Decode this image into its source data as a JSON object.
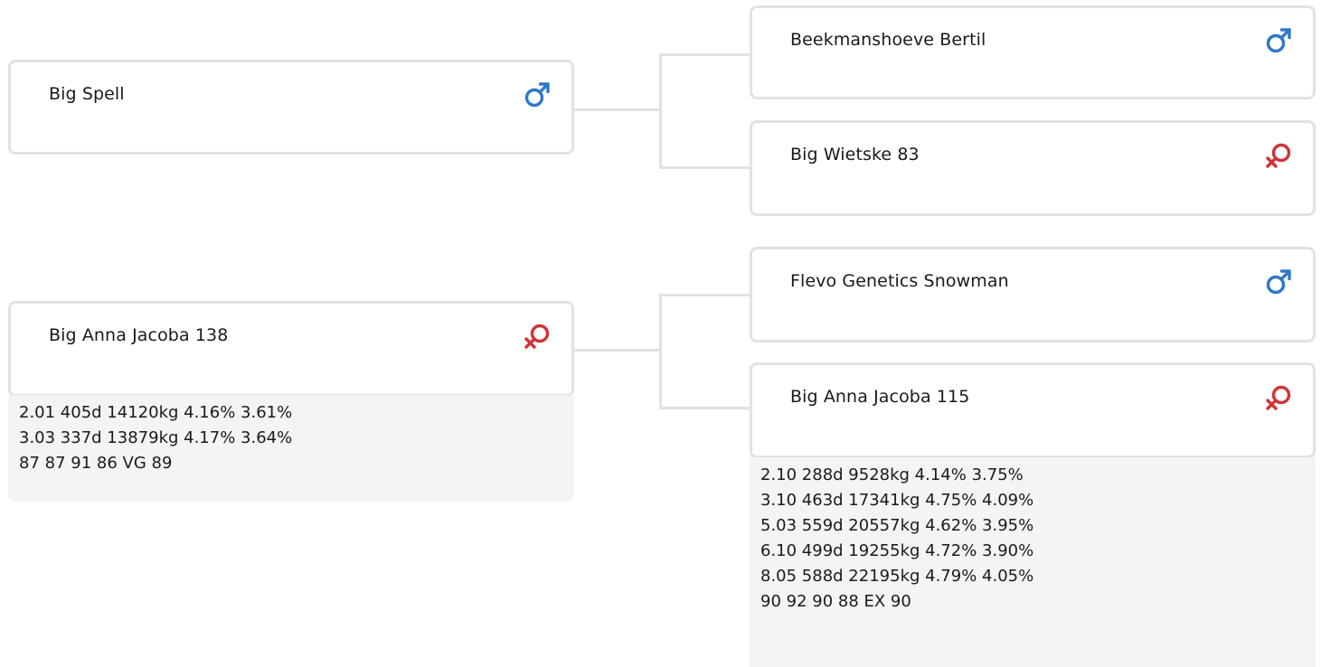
{
  "colors": {
    "male": "#2f78c8",
    "female": "#d03339",
    "border": "#e2e2e2",
    "stats_background": "#f4f4f4"
  },
  "parents": {
    "sire": {
      "name": "Big Spell",
      "sex": "male",
      "icon": "male-symbol-icon"
    },
    "dam": {
      "name": "Big Anna Jacoba 138",
      "sex": "female",
      "icon": "female-symbol-icon",
      "stats": [
        "2.01 405d 14120kg 4.16% 3.61%",
        "3.03 337d 13879kg 4.17% 3.64%",
        "87 87 91 86 VG 89"
      ]
    }
  },
  "grandparents": {
    "sire_sire": {
      "name": "Beekmanshoeve Bertil",
      "sex": "male",
      "icon": "male-symbol-icon"
    },
    "sire_dam": {
      "name": "Big Wietske 83",
      "sex": "female",
      "icon": "female-symbol-icon"
    },
    "dam_sire": {
      "name": "Flevo Genetics Snowman",
      "sex": "male",
      "icon": "male-symbol-icon"
    },
    "dam_dam": {
      "name": "Big Anna Jacoba 115",
      "sex": "female",
      "icon": "female-symbol-icon",
      "stats": [
        "2.10 288d 9528kg 4.14% 3.75%",
        "3.10 463d 17341kg 4.75% 4.09%",
        "5.03 559d 20557kg 4.62% 3.95%",
        "6.10 499d 19255kg 4.72% 3.90%",
        "8.05 588d 22195kg 4.79% 4.05%",
        "90 92 90 88 EX 90"
      ]
    }
  }
}
